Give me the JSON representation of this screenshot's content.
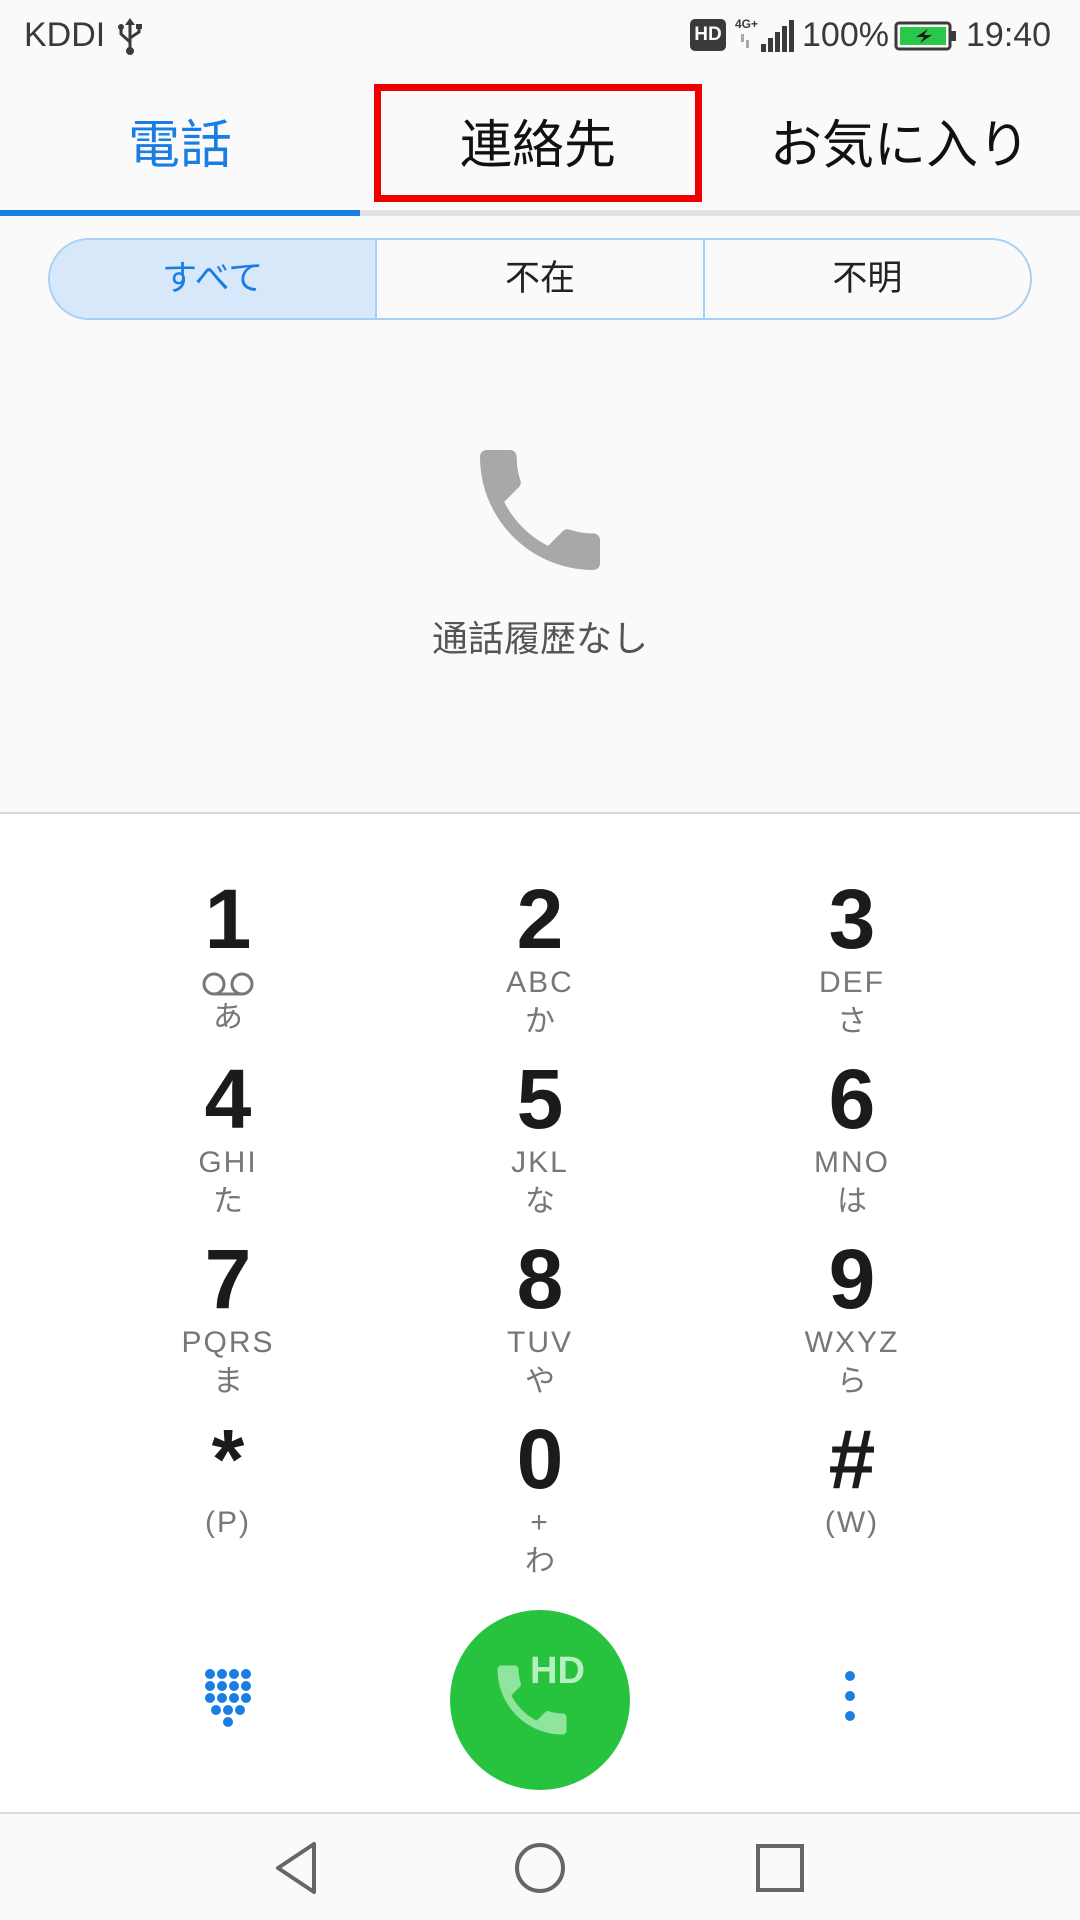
{
  "status_bar": {
    "carrier": "KDDI",
    "network_badge": "HD",
    "battery_percent": "100%",
    "time": "19:40",
    "icons": [
      "usb-icon",
      "signal-icon",
      "battery-icon"
    ]
  },
  "tabs": [
    {
      "label": "電話",
      "active": true
    },
    {
      "label": "連絡先",
      "active": false
    },
    {
      "label": "お気に入り",
      "active": false
    }
  ],
  "filters": [
    {
      "label": "すべて",
      "selected": true
    },
    {
      "label": "不在",
      "selected": false
    },
    {
      "label": "不明",
      "selected": false
    }
  ],
  "empty_state": {
    "icon": "phone-icon",
    "text": "通話履歴なし"
  },
  "dialpad": {
    "keys": [
      {
        "digit": "1",
        "letters": "",
        "kana": "あ",
        "icon": "voicemail-icon"
      },
      {
        "digit": "2",
        "letters": "ABC",
        "kana": "か"
      },
      {
        "digit": "3",
        "letters": "DEF",
        "kana": "さ"
      },
      {
        "digit": "4",
        "letters": "GHI",
        "kana": "た"
      },
      {
        "digit": "5",
        "letters": "JKL",
        "kana": "な"
      },
      {
        "digit": "6",
        "letters": "MNO",
        "kana": "は"
      },
      {
        "digit": "7",
        "letters": "PQRS",
        "kana": "ま"
      },
      {
        "digit": "8",
        "letters": "TUV",
        "kana": "や"
      },
      {
        "digit": "9",
        "letters": "WXYZ",
        "kana": "ら"
      },
      {
        "digit": "*",
        "letters": "(P)",
        "kana": ""
      },
      {
        "digit": "0",
        "letters": "+",
        "kana": "わ"
      },
      {
        "digit": "#",
        "letters": "(W)",
        "kana": ""
      }
    ]
  },
  "actions": {
    "call_label": "HD",
    "dialpad_toggle_icon": "dialpad-icon",
    "more_icon": "more-vert-icon"
  },
  "colors": {
    "accent": "#1a7de3",
    "call_green": "#27c33f",
    "highlight_red": "#ee0000"
  }
}
